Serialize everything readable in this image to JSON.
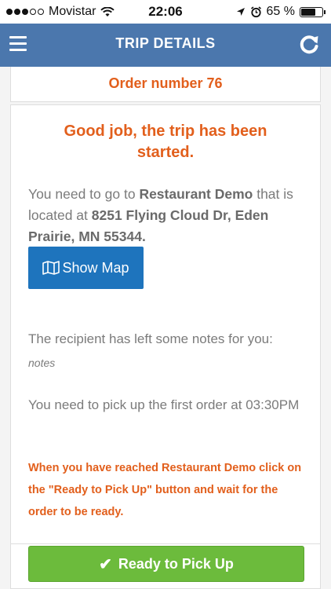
{
  "status_bar": {
    "carrier": "Movistar",
    "time": "22:06",
    "battery": "65 %",
    "battery_level": 0.65
  },
  "nav": {
    "title": "TRIP DETAILS",
    "menu_icon": "hamburger-menu-icon",
    "refresh_icon": "refresh-icon"
  },
  "order": {
    "number_label": "Order number 76"
  },
  "trip": {
    "headline": "Good job, the trip has been started.",
    "go_prefix": "You need to go to ",
    "restaurant": "Restaurant Demo",
    "located_text": " that is located at ",
    "address": "8251 Flying Cloud Dr, Eden Prairie, MN 55344.",
    "show_map_label": "Show Map",
    "notes_label": "The recipient has left some notes for you:",
    "notes": "notes",
    "pickup_text": "You need to pick up the first order at 03:30PM",
    "instruction": "When you have reached Restaurant Demo click on the \"Ready to Pick Up\" button and wait for the order to be ready."
  },
  "footer": {
    "ready_label": "Ready to Pick Up"
  },
  "colors": {
    "nav_bg": "#4b77ad",
    "accent_orange": "#e25f1c",
    "map_button": "#1e74bd",
    "ready_button": "#6cbb3c"
  }
}
